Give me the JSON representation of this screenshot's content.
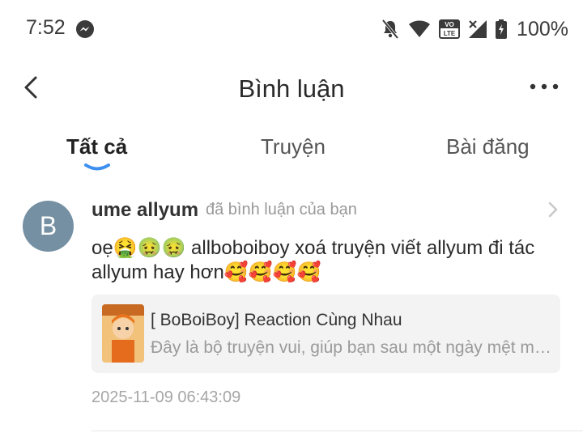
{
  "status_bar": {
    "time": "7:52",
    "battery": "100%",
    "lte_label": "VO LTE"
  },
  "header": {
    "title": "Bình luận"
  },
  "tabs": [
    {
      "label": "Tất cả",
      "active": true
    },
    {
      "label": "Truyện",
      "active": false
    },
    {
      "label": "Bài đăng",
      "active": false
    }
  ],
  "comment": {
    "avatar_letter": "B",
    "avatar_color": "#7590a3",
    "user": "ume allyum",
    "action": "đã bình luận của bạn",
    "text": "oẹ🤮🤢🤢 allboboiboy xoá truyện viết allyum đi tác allyum hay hơn🥰🥰🥰🥰",
    "story": {
      "title": "[ BoBoiBoy] Reaction Cùng Nhau",
      "description": "Đây là bộ truyện vui, giúp bạn sau một ngày mệt mỏi có thể thư giãn"
    },
    "timestamp": "2025-11-09 06:43:09"
  },
  "colors": {
    "accent": "#3d8ff0"
  },
  "icons": [
    "messenger-icon",
    "mute-icon",
    "wifi-icon",
    "lte-icon",
    "signal-icon",
    "battery-icon",
    "back-icon",
    "more-icon",
    "chevron-right-icon"
  ]
}
